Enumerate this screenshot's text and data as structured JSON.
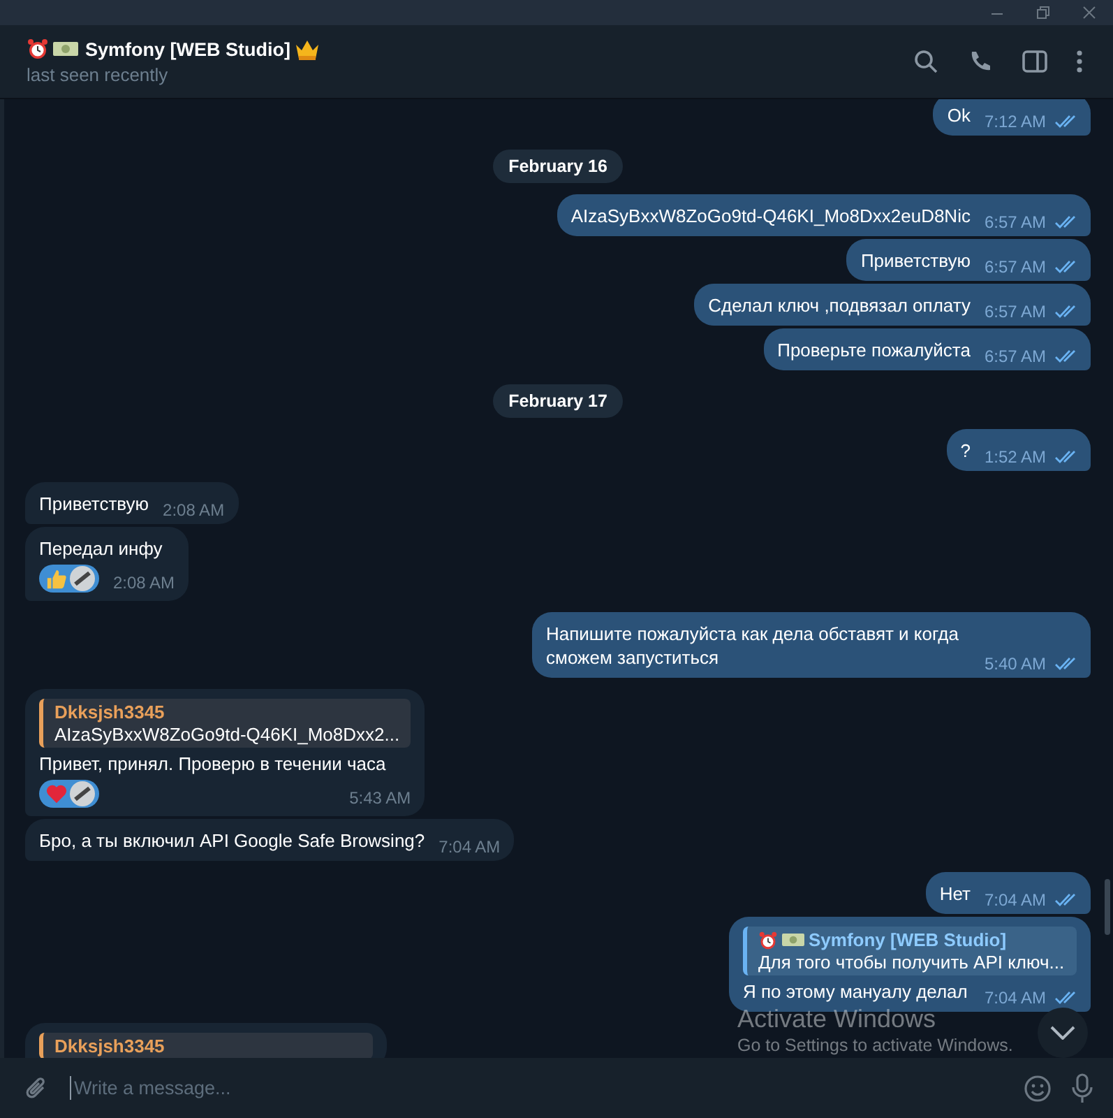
{
  "header": {
    "title": "Symfony [WEB Studio]",
    "status": "last seen recently"
  },
  "messages": [
    {
      "kind": "out",
      "text": "Ok",
      "time": "7:12 AM",
      "read": true
    },
    {
      "kind": "date",
      "text": "February 16"
    },
    {
      "kind": "out",
      "text": "AIzaSyBxxW8ZoGo9td-Q46KI_Mo8Dxx2euD8Nic",
      "time": "6:57 AM",
      "read": true
    },
    {
      "kind": "out",
      "text": "Приветствую",
      "time": "6:57 AM",
      "read": true
    },
    {
      "kind": "out",
      "text": "Сделал ключ ,подвязал оплату",
      "time": "6:57 AM",
      "read": true
    },
    {
      "kind": "out",
      "text": "Проверьте пожалуйста",
      "time": "6:57 AM",
      "read": true
    },
    {
      "kind": "date",
      "text": "February 17"
    },
    {
      "kind": "out",
      "text": "?",
      "time": "1:52 AM",
      "read": true
    },
    {
      "kind": "in",
      "text": "Приветствую",
      "time": "2:08 AM"
    },
    {
      "kind": "in",
      "text": "Передал инфу",
      "time": "2:08 AM",
      "reactions": [
        {
          "kind": "thumbs_up"
        }
      ]
    },
    {
      "kind": "out",
      "text": "Напишите пожалуйста как дела обставят и когда сможем запуститься",
      "time": "5:40 AM",
      "read": true
    },
    {
      "kind": "in",
      "reply": {
        "name": "Dkksjsh3345",
        "text": "AIzaSyBxxW8ZoGo9td-Q46KI_Mo8Dxx2..."
      },
      "text": "Привет, принял. Проверю в течении часа",
      "time": "5:43 AM",
      "reactions": [
        {
          "kind": "heart"
        }
      ]
    },
    {
      "kind": "in",
      "text": "Бро, а ты включил  API Google Safe Browsing?",
      "time": "7:04 AM"
    },
    {
      "kind": "out",
      "text": "Нет",
      "time": "7:04 AM",
      "read": true
    },
    {
      "kind": "out",
      "reply": {
        "name": "Symfony [WEB Studio]",
        "text": "Для того чтобы получить API ключ..."
      },
      "text": "Я по этому мануалу делал",
      "time": "7:04 AM",
      "read": true
    },
    {
      "kind": "in",
      "reply": {
        "name": "Dkksjsh3345"
      }
    }
  ],
  "overlay": {
    "title": "Activate Windows",
    "text": "Go to Settings to activate Windows."
  },
  "composer": {
    "placeholder": "Write a message..."
  }
}
